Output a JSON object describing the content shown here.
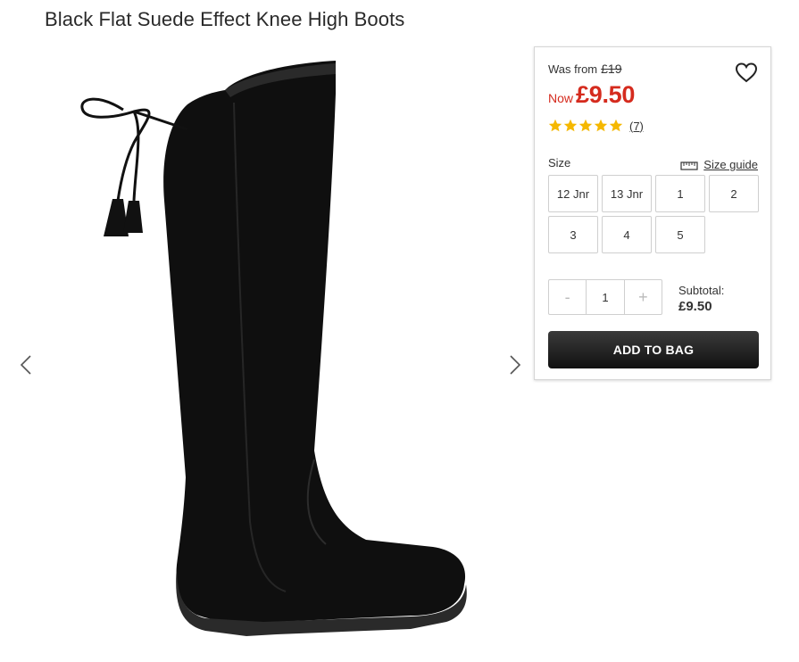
{
  "product": {
    "title": "Black Flat Suede Effect Knee High Boots"
  },
  "gallery": {
    "prev_icon": "chevron-left-icon",
    "next_icon": "chevron-right-icon"
  },
  "price": {
    "was_label": "Was from",
    "was_value": "£19",
    "now_label": "Now",
    "now_value": "£9.50",
    "now_color": "#d52b1e"
  },
  "rating": {
    "stars": 5,
    "count_text": "(7)",
    "star_color": "#f5b800"
  },
  "size": {
    "label": "Size",
    "guide_label": "Size guide",
    "options": [
      "12 Jnr",
      "13 Jnr",
      "1",
      "2",
      "3",
      "4",
      "5"
    ]
  },
  "quantity": {
    "minus": "-",
    "value": "1",
    "plus": "+"
  },
  "subtotal": {
    "label": "Subtotal:",
    "value": "£9.50"
  },
  "cta": {
    "add_to_bag": "ADD TO BAG"
  }
}
